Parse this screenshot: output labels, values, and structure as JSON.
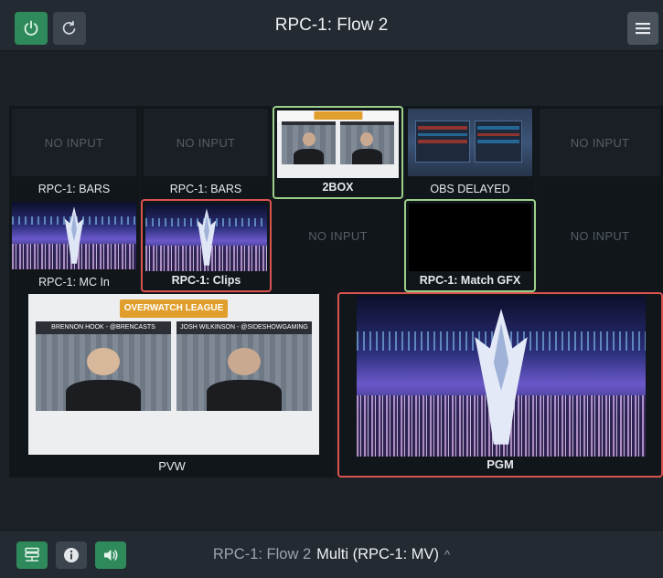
{
  "app": {
    "title": "RPC-1: Flow 2",
    "power_icon": "power-icon",
    "refresh_icon": "refresh-icon",
    "menu_icon": "hamburger-menu-icon",
    "accent_green": "#2f8a5b",
    "tally_red": "#d9534f",
    "tally_green": "#9bd08a"
  },
  "multiview": {
    "row1": [
      {
        "label": "RPC-1: BARS",
        "status": "NO INPUT"
      },
      {
        "label": "RPC-1: BARS",
        "status": "NO INPUT"
      },
      {
        "label": "2BOX",
        "status": ""
      },
      {
        "label": "OBS DELAYED",
        "status": ""
      },
      {
        "label": "",
        "status": "NO INPUT"
      }
    ],
    "row2": [
      {
        "label": "RPC-1: MC In",
        "status": ""
      },
      {
        "label": "RPC-1: Clips",
        "status": ""
      },
      {
        "label": "",
        "status": "NO INPUT"
      },
      {
        "label": "RPC-1: Match GFX",
        "status": ""
      },
      {
        "label": "",
        "status": "NO INPUT"
      }
    ],
    "preview_label": "PVW",
    "program_label": "PGM",
    "preview_names": [
      "BRENNON HOOK - @BRENCASTS",
      "JOSH WILKINSON - @SIDESHOWGAMING"
    ],
    "preview_logo": "OVERWATCH LEAGUE"
  },
  "footer": {
    "flow": "RPC-1: Flow 2",
    "mode": "Multi (RPC-1: MV)",
    "caret": "^",
    "network_icon": "network-server-icon",
    "info_icon": "info-icon",
    "volume_icon": "volume-icon"
  }
}
